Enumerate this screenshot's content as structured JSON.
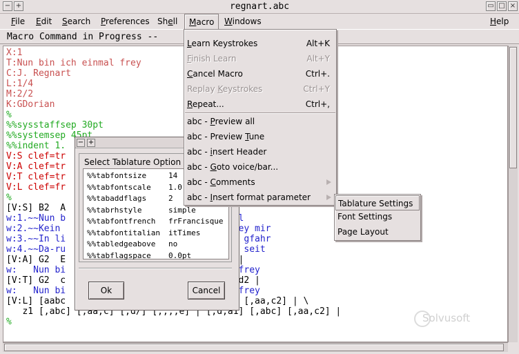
{
  "window": {
    "title": "regnart.abc"
  },
  "menubar": {
    "file": {
      "pre": "",
      "ul": "F",
      "post": "ile"
    },
    "edit": {
      "pre": "",
      "ul": "E",
      "post": "dit"
    },
    "search": {
      "pre": "",
      "ul": "S",
      "post": "earch"
    },
    "preferences": {
      "pre": "",
      "ul": "P",
      "post": "references"
    },
    "shell": {
      "pre": "Sh",
      "ul": "e",
      "post": "ll"
    },
    "macro": {
      "pre": "",
      "ul": "M",
      "post": "acro"
    },
    "windows": {
      "pre": "",
      "ul": "W",
      "post": "indows"
    },
    "help": {
      "pre": "",
      "ul": "H",
      "post": "elp"
    }
  },
  "status": "Macro Command in Progress --",
  "editor_lines": [
    {
      "text": "X:1",
      "color": "#c85050"
    },
    {
      "text": "T:Nun bin ich einmal frey",
      "color": "#c85050"
    },
    {
      "text": "C:J. Regnart",
      "color": "#c85050"
    },
    {
      "text": "L:1/4",
      "color": "#c85050"
    },
    {
      "text": "M:2/2",
      "color": "#c85050"
    },
    {
      "text": "K:GDorian",
      "color": "#c85050"
    },
    {
      "text": "%",
      "color": "#22aa22"
    },
    {
      "text": "%%sysstaffsep 30pt",
      "color": "#22aa22"
    },
    {
      "text": "%%systemsep 45pt",
      "color": "#22aa22"
    },
    {
      "text": "%%indent 1.",
      "color": "#22aa22"
    },
    {
      "text": "V:S clef=tr",
      "color": "#cc0000"
    },
    {
      "text": "V:A clef=tr",
      "color": "#cc0000"
    },
    {
      "text": "V:T clef=tr",
      "color": "#cc0000"
    },
    {
      "text": "V:L clef=fr",
      "color": "#cc0000"
    },
    {
      "text": "%",
      "color": "#22aa22"
    },
    {
      "text": "[V:S] B2  A                   A   d | c   B",
      "color": "#000000"
    },
    {
      "text": "w:1.~~Nun b                  bin ich ein-mal",
      "color": "#2222cc"
    },
    {
      "text": "w:2.~~Kein                   trau-ren ist bey mir",
      "color": "#2222cc"
    },
    {
      "text": "w:3.~~In li                  eb hab ich der gfahr",
      "color": "#2222cc"
    },
    {
      "text": "w:4.~~Da-ru                  mb all, die ir seit",
      "color": "#2222cc"
    },
    {
      "text": "[V:A] G2  E                 B | A   G  ^F2 |",
      "color": "#000000"
    },
    {
      "text": "w:   Nun bi                  n ich ein-mal frey",
      "color": "#2222cc"
    },
    {
      "text": "[V:T] G2  c                  > e | f   g   d2 |",
      "color": "#000000"
    },
    {
      "text": "w:   Nun bi                  n ich ein-mal frey",
      "color": "#2222cc"
    },
    {
      "text": "[V:L] [aabc                  [,d,a1] [,abc] [,aa,c2] | \\",
      "color": "#000000"
    },
    {
      "text": "   z1 [,abc] [,aa,c] [,d/] [,,,,e] | [,d,a1] [,abc] [,aa,c2] |",
      "color": "#000000"
    },
    {
      "text": "%",
      "color": "#22aa22"
    }
  ],
  "watermark": "Solvusoft",
  "dialog": {
    "group_label": "Select Tablature Option",
    "options": [
      {
        "key": "%%tabfontsize",
        "value": "14"
      },
      {
        "key": "%%tabfontscale",
        "value": "1.0"
      },
      {
        "key": "%%tabaddflags",
        "value": "2"
      },
      {
        "key": "%%tabrhstyle",
        "value": "simple"
      },
      {
        "key": "%%tabfontfrench",
        "value": "frFrancisque"
      },
      {
        "key": "%%tabfontitalian",
        "value": "itTimes"
      },
      {
        "key": "%%tabledgeabove",
        "value": "no"
      },
      {
        "key": "%%tabflagspace",
        "value": "0.0pt"
      }
    ],
    "ok_label": "Ok",
    "cancel_label": "Cancel"
  },
  "macro_menu": {
    "learn": {
      "pre": "",
      "ul": "L",
      "post": "earn Keystrokes",
      "accel": "Alt+K"
    },
    "finish": {
      "pre": "",
      "ul": "F",
      "post": "inish Learn",
      "accel": "Alt+Y"
    },
    "cancel": {
      "pre": "",
      "ul": "C",
      "post": "ancel Macro",
      "accel": "Ctrl+."
    },
    "replay": {
      "pre": "Replay ",
      "ul": "K",
      "post": "eystrokes",
      "accel": "Ctrl+Y"
    },
    "repeat": {
      "pre": "",
      "ul": "R",
      "post": "epeat...",
      "accel": "Ctrl+,"
    },
    "preview_all": {
      "pre": "abc - ",
      "ul": "P",
      "post": "review all"
    },
    "preview_tune": {
      "pre": "abc - Preview ",
      "ul": "T",
      "post": "une"
    },
    "insert_header": {
      "pre": "abc - ",
      "ul": "i",
      "post": "nsert Header"
    },
    "goto": {
      "pre": "abc - ",
      "ul": "G",
      "post": "oto voice/bar..."
    },
    "comments": {
      "pre": "abc - ",
      "ul": "C",
      "post": "omments"
    },
    "insert_format": {
      "pre": "abc - ",
      "ul": "I",
      "post": "nsert format parameter"
    }
  },
  "submenu": {
    "tablature": "Tablature Settings",
    "font": "Font Settings",
    "page": "Page Layout"
  }
}
